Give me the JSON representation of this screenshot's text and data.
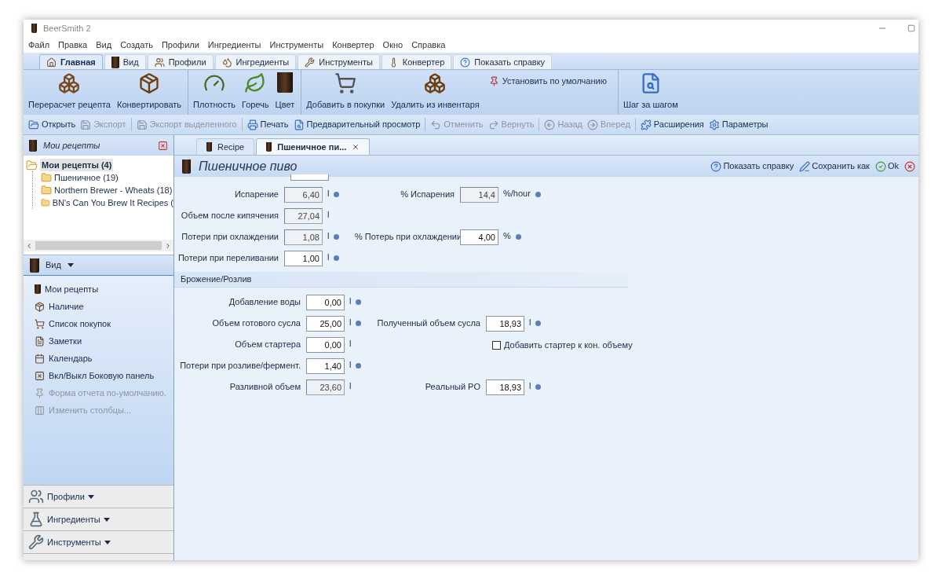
{
  "window": {
    "title": "BeerSmith 2"
  },
  "menu": [
    "Файл",
    "Правка",
    "Вид",
    "Создать",
    "Профили",
    "Ингредиенты",
    "Инструменты",
    "Конвертер",
    "Окно",
    "Справка"
  ],
  "ribbon_tabs": [
    {
      "label": "Главная",
      "selected": true
    },
    {
      "label": "Вид",
      "selected": false
    },
    {
      "label": "Профили",
      "selected": false
    },
    {
      "label": "Ингредиенты",
      "selected": false
    },
    {
      "label": "Инструменты",
      "selected": false
    },
    {
      "label": "Конвертер",
      "selected": false
    },
    {
      "label": "Показать справку",
      "selected": false
    }
  ],
  "ribbon": {
    "groups": [
      {
        "buttons": [
          {
            "label": "Перерасчет рецепта",
            "kind": "large"
          },
          {
            "label": "Конвертировать",
            "kind": "large"
          }
        ]
      },
      {
        "buttons": [
          {
            "label": "Плотность",
            "kind": "large"
          },
          {
            "label": "Горечь",
            "kind": "large"
          },
          {
            "label": "Цвет",
            "kind": "large"
          }
        ]
      },
      {
        "buttons": [
          {
            "label": "Добавить в покупки",
            "kind": "large"
          },
          {
            "label": "Удалить из инвентаря",
            "kind": "large"
          },
          {
            "label": "Установить по умолчанию",
            "kind": "small"
          }
        ]
      },
      {
        "buttons": [
          {
            "label": "Шаг за шагом",
            "kind": "large"
          }
        ]
      }
    ]
  },
  "toolbar": {
    "groups": [
      [
        {
          "label": "Открыть",
          "disabled": false
        },
        {
          "label": "Экспорт",
          "disabled": true
        }
      ],
      [
        {
          "label": "Экспорт выделенного",
          "disabled": true
        }
      ],
      [
        {
          "label": "Печать",
          "disabled": false
        },
        {
          "label": "Предварительный просмотр",
          "disabled": false
        }
      ],
      [
        {
          "label": "Отменить",
          "disabled": true
        },
        {
          "label": "Вернуть",
          "disabled": true
        }
      ],
      [
        {
          "label": "Назад",
          "disabled": true
        },
        {
          "label": "Вперед",
          "disabled": true
        }
      ],
      [
        {
          "label": "Расширения",
          "disabled": false
        },
        {
          "label": "Параметры",
          "disabled": false
        }
      ]
    ]
  },
  "sidebar": {
    "recipes_panel": {
      "title": "Мои рецепты",
      "tree": [
        {
          "label": "Мои рецепты (4)",
          "selected": true,
          "expanded": true,
          "children": [
            {
              "label": "Пшеничное (19)",
              "selected": false
            },
            {
              "label": "Northern Brewer - Wheats (18)",
              "selected": false
            },
            {
              "label": "BN's Can You Brew It Recipes (",
              "selected": false
            }
          ]
        }
      ]
    },
    "view_panel": {
      "title": "Вид",
      "items": [
        {
          "label": "Мои рецепты",
          "disabled": false
        },
        {
          "label": "Наличие",
          "disabled": false
        },
        {
          "label": "Список покупок",
          "disabled": false
        },
        {
          "label": "Заметки",
          "disabled": false
        },
        {
          "label": "Календарь",
          "disabled": false
        },
        {
          "label": "Вкл/Выкл Боковую панель",
          "disabled": false
        },
        {
          "label": "Форма отчета по-умолчанию.",
          "disabled": true
        },
        {
          "label": "Изменить столбцы...",
          "disabled": true
        }
      ]
    },
    "groups": [
      {
        "label": "Профили"
      },
      {
        "label": "Ингредиенты"
      },
      {
        "label": "Инструменты"
      }
    ]
  },
  "document_tabs": [
    {
      "label": "Recipe",
      "selected": false,
      "closable": false
    },
    {
      "label": "Пшеничное пи...",
      "selected": true,
      "closable": true
    }
  ],
  "recipe": {
    "title": "Пшеничное пиво",
    "actions": [
      {
        "label": "Показать справку"
      },
      {
        "label": "Сохранить как"
      },
      {
        "label": "Ok"
      }
    ],
    "sections": [
      {
        "rows": [
          {
            "left": {
              "label": "Испарение",
              "value": "6,40",
              "unit": "l",
              "readonly": true,
              "info": true
            },
            "right": {
              "kind": "field",
              "label": "% Испарения",
              "value": "14,4",
              "unit": "%/hour",
              "readonly": true,
              "info": true
            }
          },
          {
            "left": {
              "label": "Объем после кипячения",
              "value": "27,04",
              "unit": "l",
              "readonly": true,
              "info": false
            }
          },
          {
            "left": {
              "label": "Потери при охлаждении",
              "value": "1,08",
              "unit": "l",
              "readonly": true,
              "info": true
            },
            "right": {
              "kind": "field",
              "label": "% Потерь при охлаждении",
              "value": "4,00",
              "unit": "%",
              "readonly": false,
              "info": true
            }
          },
          {
            "left": {
              "label": "Потери при переливании",
              "value": "1,00",
              "unit": "l",
              "readonly": false,
              "info": true
            }
          }
        ]
      },
      {
        "title": "Брожение/Розлив",
        "rows": [
          {
            "left": {
              "label": "Добавление воды",
              "value": "0,00",
              "unit": "l",
              "readonly": false,
              "info": true
            }
          },
          {
            "left": {
              "label": "Объем готового сусла",
              "value": "25,00",
              "unit": "l",
              "readonly": false,
              "info": true
            },
            "right": {
              "kind": "field",
              "label": "Полученный объем сусла",
              "value": "18,93",
              "unit": "l",
              "readonly": false,
              "info": true
            }
          },
          {
            "left": {
              "label": "Объем стартера",
              "value": "0,00",
              "unit": "l",
              "readonly": false,
              "info": false
            },
            "right": {
              "kind": "checkbox",
              "label": "Добавить стартер к кон. объему",
              "checked": false
            }
          },
          {
            "left": {
              "label": "Потери при розливе/фермент.",
              "value": "1,40",
              "unit": "l",
              "readonly": false,
              "info": true
            }
          },
          {
            "left": {
              "label": "Разливной объем",
              "value": "23,60",
              "unit": "l",
              "readonly": true,
              "info": false
            },
            "right": {
              "kind": "field",
              "label": "Реальный PO",
              "value": "18,93",
              "unit": "l",
              "readonly": false,
              "info": true
            }
          }
        ]
      }
    ]
  }
}
